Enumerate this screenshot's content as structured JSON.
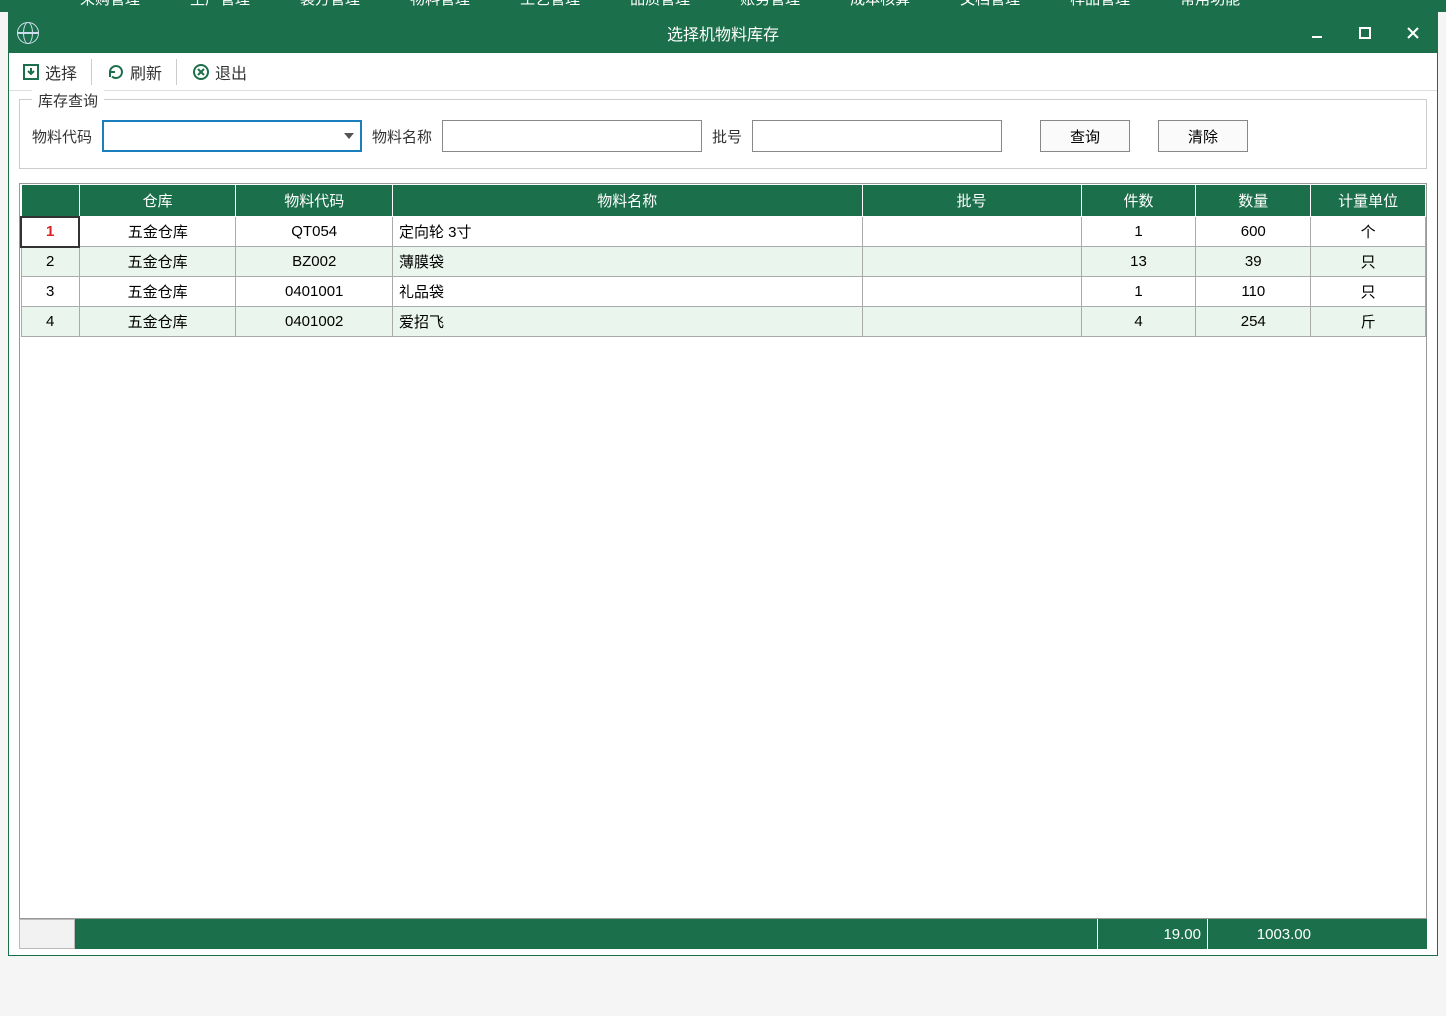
{
  "bg_menu": [
    "采购管理",
    "生产管理",
    "装方管理",
    "物料管理",
    "工艺管理",
    "品质管理",
    "账务管理",
    "成本核算",
    "文档管理",
    "样品管理",
    "常用功能"
  ],
  "window": {
    "title": "选择机物料库存"
  },
  "toolbar": {
    "select_label": "选择",
    "refresh_label": "刷新",
    "exit_label": "退出"
  },
  "filter": {
    "legend": "库存查询",
    "code_label": "物料代码",
    "code_value": "",
    "name_label": "物料名称",
    "name_value": "",
    "batch_label": "批号",
    "batch_value": "",
    "query_btn": "查询",
    "clear_btn": "清除"
  },
  "grid": {
    "headers": {
      "warehouse": "仓库",
      "code": "物料代码",
      "name": "物料名称",
      "batch": "批号",
      "count": "件数",
      "qty": "数量",
      "unit": "计量单位"
    },
    "rows": [
      {
        "idx": "1",
        "warehouse": "五金仓库",
        "code": "QT054",
        "name": "定向轮 3寸",
        "batch": "",
        "count": "1",
        "qty": "600",
        "unit": "个"
      },
      {
        "idx": "2",
        "warehouse": "五金仓库",
        "code": "BZ002",
        "name": "薄膜袋",
        "batch": "",
        "count": "13",
        "qty": "39",
        "unit": "只"
      },
      {
        "idx": "3",
        "warehouse": "五金仓库",
        "code": "0401001",
        "name": "礼品袋",
        "batch": "",
        "count": "1",
        "qty": "110",
        "unit": "只"
      },
      {
        "idx": "4",
        "warehouse": "五金仓库",
        "code": "0401002",
        "name": "爱招飞",
        "batch": "",
        "count": "4",
        "qty": "254",
        "unit": "斤"
      }
    ]
  },
  "footer": {
    "count_total": "19.00",
    "qty_total": "1003.00"
  }
}
